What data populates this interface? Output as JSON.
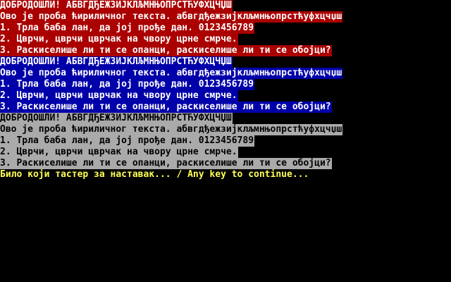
{
  "blocks": [
    {
      "scheme": "red",
      "lines": [
        "ДОБРОДОШЛИ! АБВГДЂЕЖЗИЈКЛЉМНЊОПРСТЋУФХЦЧЏШ",
        "Ово је проба ћириличног текста. абвгдђежзијклљмнњопрстћуфхцчџш",
        "1. Трла баба лан, да јој прође дан. 0123456789",
        "2. Цврчи, цврчи цврчак на чвору црне смрче.",
        "3. Раскиселише ли ти се опанци, раскиселише ли ти се обојци?"
      ]
    },
    {
      "scheme": "blue",
      "lines": [
        "ДОБРОДОШЛИ! АБВГДЂЕЖЗИЈКЛЉМНЊОПРСТЋУФХЦЧЏШ",
        "Ово је проба ћириличног текста. абвгдђежзијклљмнњопрстћуфхцчџш",
        "1. Трла баба лан, да јој прође дан. 0123456789",
        "2. Цврчи, цврчи цврчак на чвору црне смрче.",
        "3. Раскиселише ли ти се опанци, раскиселише ли ти се обојци?"
      ]
    },
    {
      "scheme": "gray",
      "lines": [
        "ДОБРОДОШЛИ! АБВГДЂЕЖЗИЈКЛЉМНЊОПРСТЋУФХЦЧЏШ",
        "Ово је проба ћириличног текста. абвгдђежзијклљмнњопрстћуфхцчџш",
        "1. Трла баба лан, да јој прође дан. 0123456789",
        "2. Цврчи, цврчи цврчак на чвору црне смрче.",
        "3. Раскиселише ли ти се опанци, раскиселише ли ти се обојци?"
      ]
    }
  ],
  "prompt": "Било који тастер за наставак... / Any key to continue...",
  "colors": {
    "background": "#000000",
    "red": "#aa0000",
    "blue": "#0000aa",
    "gray": "#aaaaaa",
    "text_light": "#ffffff",
    "text_dark": "#000000",
    "prompt": "#ffff55"
  }
}
